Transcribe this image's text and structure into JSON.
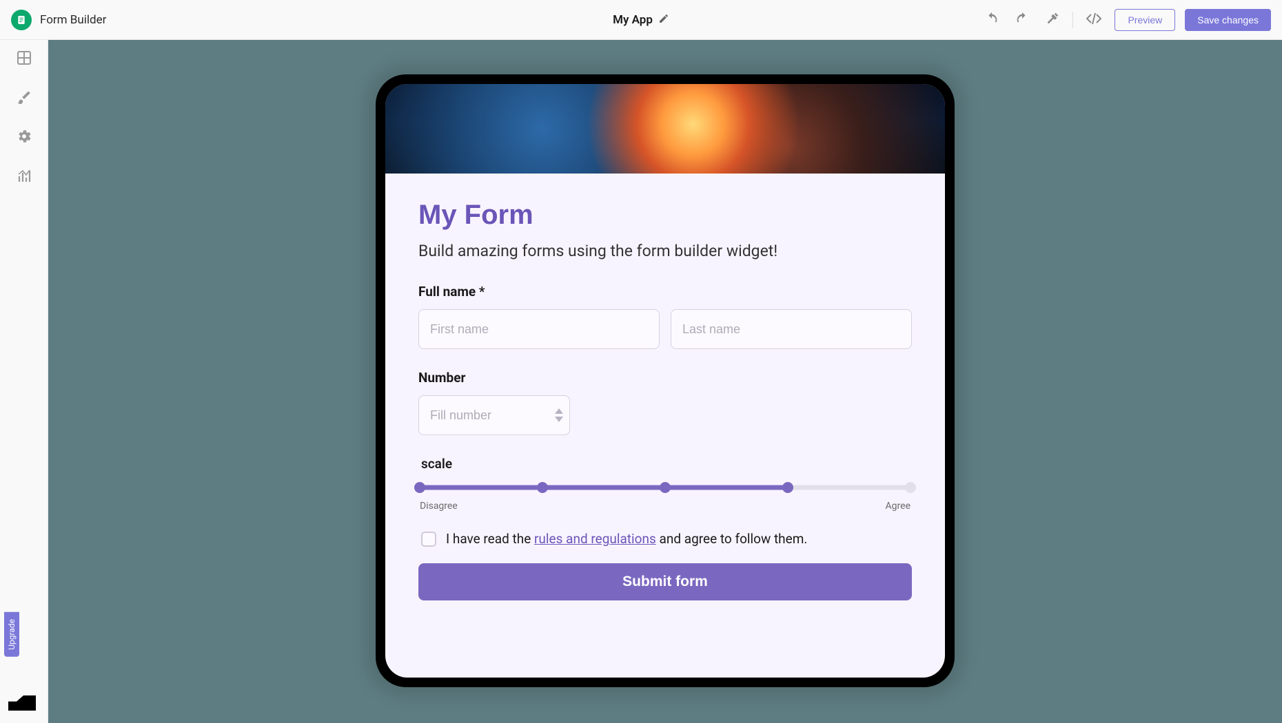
{
  "header": {
    "app_label": "Form Builder",
    "app_name": "My App",
    "preview": "Preview",
    "save": "Save changes"
  },
  "sidebar": {
    "upgrade": "Upgrade"
  },
  "form": {
    "title": "My Form",
    "subtitle": "Build amazing forms using the form builder widget!",
    "fullname_label": "Full name *",
    "first_placeholder": "First name",
    "last_placeholder": "Last name",
    "number_label": "Number",
    "number_placeholder": "Fill number",
    "scale_label": "scale",
    "scale_left": "Disagree",
    "scale_right": "Agree",
    "consent_prefix": "I have read the ",
    "consent_link": "rules and regulations",
    "consent_suffix": " and agree to follow them.",
    "submit": "Submit form",
    "scale_value": 4,
    "scale_max": 5
  }
}
